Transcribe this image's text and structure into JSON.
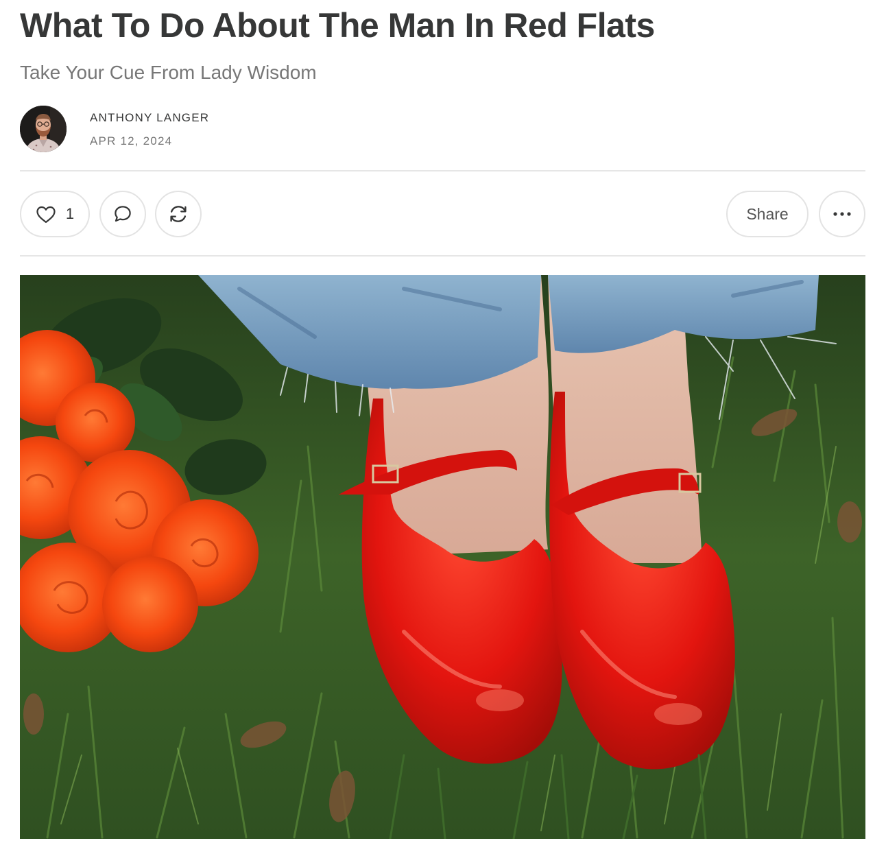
{
  "post": {
    "title": "What To Do About The Man In Red Flats",
    "subtitle": "Take Your Cue From Lady Wisdom"
  },
  "byline": {
    "author": "ANTHONY LANGER",
    "date": "APR 12, 2024"
  },
  "actions": {
    "like_count": "1",
    "share_label": "Share"
  },
  "colors": {
    "text": "#363737",
    "muted": "#777777",
    "border": "#e3e3e3",
    "shoe_red": "#e3150f",
    "rose_orange": "#f5470f"
  },
  "icons": [
    "heart-icon",
    "comment-icon",
    "restack-icon",
    "ellipsis-icon"
  ]
}
